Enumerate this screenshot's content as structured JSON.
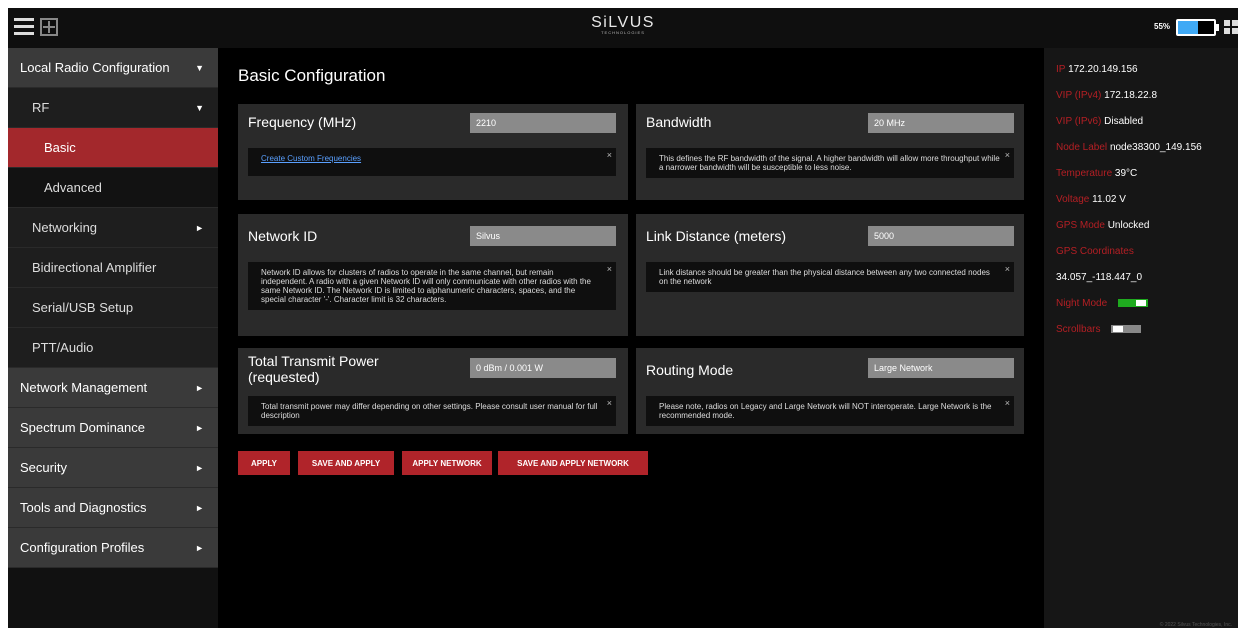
{
  "app": {
    "logo": "SiLVUS",
    "logo_sub": "TECHNOLOGIES",
    "battery_pct": "55%",
    "battery_level": 0.55
  },
  "sidebar": {
    "items": [
      {
        "label": "Local Radio Configuration",
        "arrow": "▼"
      },
      {
        "label": "RF",
        "arrow": "▼"
      },
      {
        "label": "Basic",
        "arrow": ""
      },
      {
        "label": "Advanced",
        "arrow": ""
      },
      {
        "label": "Networking",
        "arrow": "►"
      },
      {
        "label": "Bidirectional Amplifier",
        "arrow": ""
      },
      {
        "label": "Serial/USB Setup",
        "arrow": ""
      },
      {
        "label": "PTT/Audio",
        "arrow": ""
      },
      {
        "label": "Network Management",
        "arrow": "►"
      },
      {
        "label": "Spectrum Dominance",
        "arrow": "►"
      },
      {
        "label": "Security",
        "arrow": "►"
      },
      {
        "label": "Tools and Diagnostics",
        "arrow": "►"
      },
      {
        "label": "Configuration Profiles",
        "arrow": "►"
      }
    ]
  },
  "main": {
    "title": "Basic Configuration",
    "frequency": {
      "label": "Frequency (MHz)",
      "value": "2210",
      "link": "Create Custom Frequencies"
    },
    "bandwidth": {
      "label": "Bandwidth",
      "value": "20 MHz",
      "info": "This defines the RF bandwidth of the signal. A higher bandwidth will allow more throughput while a narrower bandwidth will be susceptible to less noise."
    },
    "network_id": {
      "label": "Network ID",
      "value": "Silvus",
      "info": "Network ID allows for clusters of radios to operate in the same channel, but remain independent. A radio with a given Network ID will only communicate with other radios with the same Network ID. The Network ID is limited to alphanumeric characters, spaces, and the special character '-'. Character limit is 32 characters."
    },
    "link_distance": {
      "label": "Link Distance (meters)",
      "value": "5000",
      "info": "Link distance should be greater than the physical distance between any two connected nodes on the network"
    },
    "tx_power": {
      "label": "Total Transmit Power (requested)",
      "value": "0 dBm / 0.001 W",
      "info": "Total transmit power may differ depending on other settings. Please consult user manual for full description"
    },
    "routing": {
      "label": "Routing Mode",
      "value": "Large Network",
      "info": "Please note, radios on Legacy and Large Network will NOT interoperate. Large Network is the recommended mode."
    },
    "close": "×",
    "buttons": {
      "apply": "APPLY",
      "save_apply": "SAVE AND APPLY",
      "apply_network": "APPLY NETWORK",
      "save_apply_network": "SAVE AND APPLY NETWORK"
    }
  },
  "status": {
    "ip": {
      "k": "IP",
      "v": "172.20.149.156"
    },
    "vip4": {
      "k": "VIP (IPv4)",
      "v": "172.18.22.8"
    },
    "vip6": {
      "k": "VIP (IPv6)",
      "v": "Disabled"
    },
    "node": {
      "k": "Node Label",
      "v": "node38300_149.156"
    },
    "temp": {
      "k": "Temperature",
      "v": "39°C"
    },
    "voltage": {
      "k": "Voltage",
      "v": "11.02 V"
    },
    "gps_mode": {
      "k": "GPS Mode",
      "v": "Unlocked"
    },
    "gps_coords": {
      "k": "GPS Coordinates",
      "v": "34.057_-118.447_0"
    },
    "night_mode": {
      "k": "Night Mode",
      "on": true,
      "color": "#1faa1f"
    },
    "scrollbars": {
      "k": "Scrollbars",
      "on": false,
      "color": "#888888"
    },
    "copyright": "© 2022 Silvus Technologies, Inc."
  }
}
